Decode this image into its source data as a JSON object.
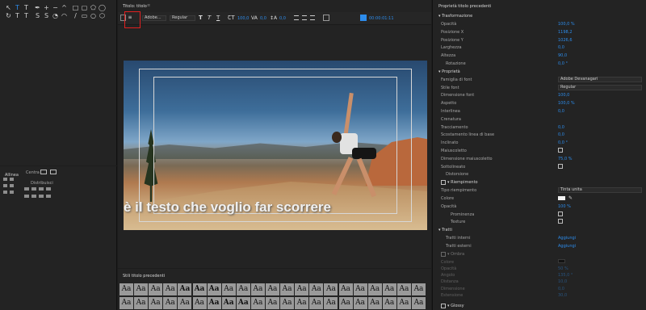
{
  "tools_panel": {
    "rows": [
      [
        "selection-tool",
        "type-tool",
        "vertical-type-tool",
        "pen-tool",
        "add-anchor-tool",
        "delete-anchor-tool",
        "convert-anchor-tool",
        "rectangle-tool",
        "rounded-rect-tool",
        "clipped-corner-tool",
        "ellipse-tool"
      ],
      [
        "rotate-tool",
        "area-type-tool",
        "vertical-area-type-tool",
        "path-type-tool",
        "vertical-path-type-tool",
        "wedge-tool",
        "arc-tool",
        "line-tool",
        "rounded-corner-rect-tool",
        "ellipse-outline-tool",
        "polygon-tool"
      ]
    ]
  },
  "align_panel": {
    "title": "Allinea",
    "center_label": "Centra",
    "distribute_label": "Distribuisci"
  },
  "title_editor": {
    "tab_label": "Titolo: titolo",
    "tab_menu": "≡",
    "toolbar": {
      "font_family": "Adobe...",
      "font_style": "Regular",
      "font_size": "100,0",
      "kerning": "0,0",
      "leading": "0,0",
      "background_video": "00:00:01:11"
    },
    "caption_text": "è il testo che voglio far scorrere"
  },
  "styles_panel": {
    "tab_label": "Stili titolo precedenti",
    "sample": "Aa"
  },
  "properties_panel": {
    "tab_label": "Proprietà titolo precedenti",
    "sections": {
      "transform": "Trasformazione",
      "properties": "Proprietà",
      "fill": "Riempimento",
      "strokes": "Tratti",
      "shadow": "Ombra",
      "glossy": "Glossy"
    },
    "transform_rows": [
      {
        "label": "Opacità",
        "value": "100,0 %"
      },
      {
        "label": "Posizione X",
        "value": "1198,2"
      },
      {
        "label": "Posizione Y",
        "value": "1026,6"
      },
      {
        "label": "Larghezza",
        "value": "0,0"
      },
      {
        "label": "Altezza",
        "value": "90,0"
      },
      {
        "label": "Rotazione",
        "value": "0,0 °"
      }
    ],
    "font_family_label": "Famiglia di font",
    "font_family_value": "Adobe Devanagari",
    "font_style_label": "Stile font",
    "font_style_value": "Regular",
    "property_rows": [
      {
        "label": "Dimensione font",
        "value": "100,0"
      },
      {
        "label": "Aspetto",
        "value": "100,0 %"
      },
      {
        "label": "Interlinea",
        "value": "0,0"
      },
      {
        "label": "Crenatura",
        "value": ""
      },
      {
        "label": "Tracciamento",
        "value": "0,0"
      },
      {
        "label": "Scostamento linea di base",
        "value": "0,0"
      },
      {
        "label": "Inclinato",
        "value": "0,0 °"
      },
      {
        "label": "Maiuscoletto",
        "value": ""
      },
      {
        "label": "Dimensione maiuscoletto",
        "value": "75,0 %"
      },
      {
        "label": "Sottolineato",
        "value": ""
      },
      {
        "label": "Distorsione",
        "value": ""
      }
    ],
    "fill_rows": [
      {
        "label": "Tipo riempimento",
        "value": "Tinta unita"
      },
      {
        "label": "Colore",
        "value": ""
      },
      {
        "label": "Opacità",
        "value": "100 %"
      },
      {
        "label": "Prominenza",
        "value": ""
      },
      {
        "label": "Texture",
        "value": ""
      }
    ],
    "stroke_rows": [
      {
        "label": "Tratti interni",
        "value": "Aggiungi"
      },
      {
        "label": "Tratti esterni",
        "value": "Aggiungi"
      }
    ],
    "shadow_rows": [
      {
        "label": "Colore",
        "value": ""
      },
      {
        "label": "Opacità",
        "value": "50 %"
      },
      {
        "label": "Angolo",
        "value": "135,0 °"
      },
      {
        "label": "Distanza",
        "value": "10,0"
      },
      {
        "label": "Dimensione",
        "value": "0,0"
      },
      {
        "label": "Estensione",
        "value": "30,0"
      }
    ]
  },
  "colors": {
    "accent": "#2d8ceb",
    "highlight": "#e02020",
    "bg_dark": "#1d1d1d",
    "panel": "#232323"
  }
}
